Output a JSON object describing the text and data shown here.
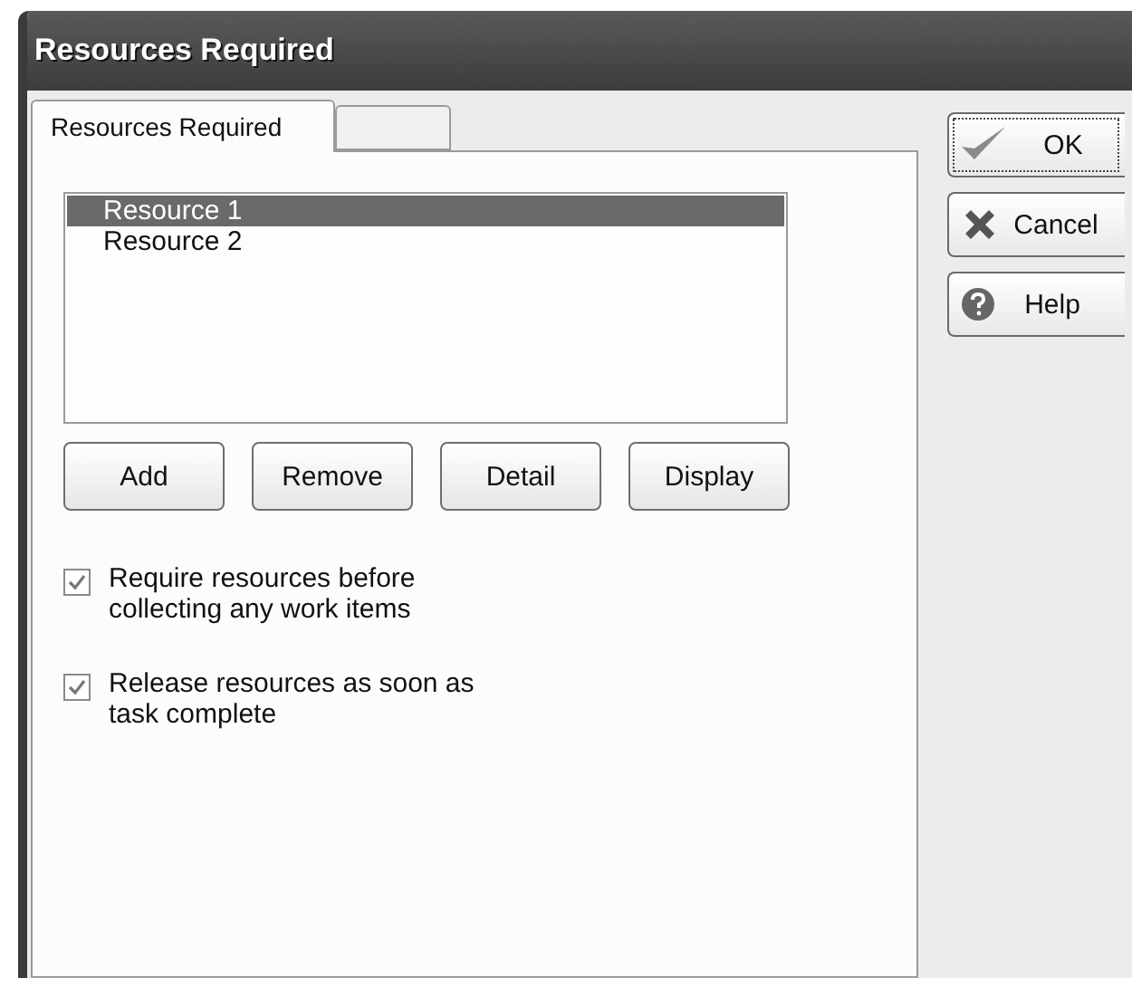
{
  "window": {
    "title": "Resources Required"
  },
  "tabs": [
    {
      "label": "Resources Required",
      "selected": true
    },
    {
      "selected": false
    }
  ],
  "resources": [
    {
      "label": "Resource 1",
      "selected": true
    },
    {
      "label": "Resource 2",
      "selected": false
    }
  ],
  "list_buttons": [
    "Add",
    "Remove",
    "Detail",
    "Display"
  ],
  "options": [
    {
      "label": "Require resources before collecting any work items",
      "checked": true
    },
    {
      "label": "Release resources as soon as task complete",
      "checked": true
    }
  ],
  "dialog_buttons": [
    {
      "label": "OK",
      "kind": "ok",
      "default": true
    },
    {
      "label": "Cancel",
      "kind": "cancel",
      "default": false
    },
    {
      "label": "Help",
      "kind": "help",
      "default": false
    }
  ]
}
